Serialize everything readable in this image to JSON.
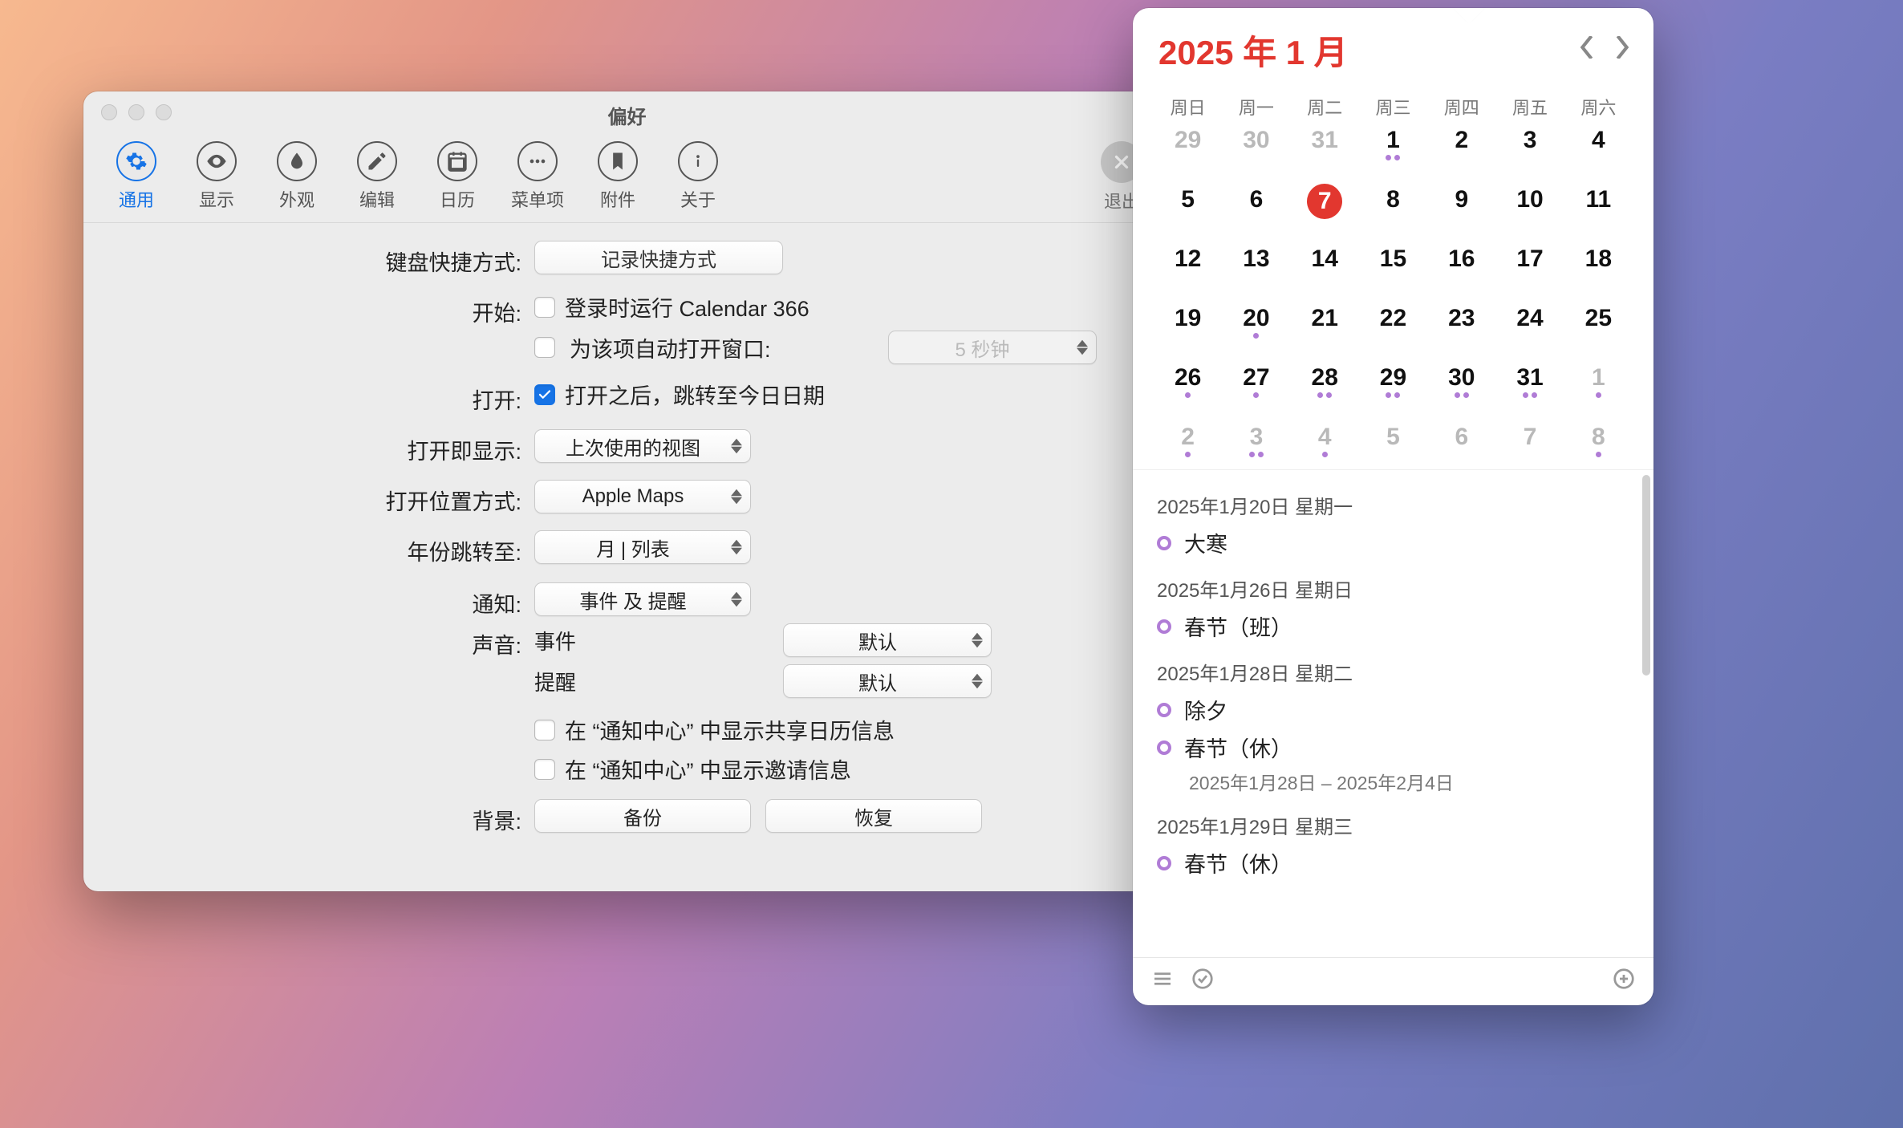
{
  "prefs": {
    "title": "偏好",
    "toolbar": [
      {
        "key": "general",
        "label": "通用",
        "active": true
      },
      {
        "key": "display",
        "label": "显示"
      },
      {
        "key": "appearance",
        "label": "外观"
      },
      {
        "key": "editing",
        "label": "编辑"
      },
      {
        "key": "calendar",
        "label": "日历"
      },
      {
        "key": "menu",
        "label": "菜单项"
      },
      {
        "key": "attachments",
        "label": "附件"
      },
      {
        "key": "about",
        "label": "关于"
      }
    ],
    "quit_label": "退出",
    "rows": {
      "keyboard_shortcut_label": "键盘快捷方式:",
      "keyboard_record_button": "记录快捷方式",
      "start_label": "开始:",
      "start_login": "登录时运行 Calendar 366",
      "start_auto_open": "为该项自动打开窗口:",
      "start_auto_open_select": "5 秒钟",
      "open_label": "打开:",
      "open_jump_today": "打开之后，跳转至今日日期",
      "open_show_label": "打开即显示:",
      "open_show_value": "上次使用的视图",
      "open_location_label": "打开位置方式:",
      "open_location_value": "Apple Maps",
      "year_jump_label": "年份跳转至:",
      "year_jump_value": "月 | 列表",
      "notify_label": "通知:",
      "notify_value": "事件 及 提醒",
      "sound_label": "声音:",
      "sound_events_label": "事件",
      "sound_events_value": "默认",
      "sound_reminders_label": "提醒",
      "sound_reminders_value": "默认",
      "nc_shared": "在 “通知中心” 中显示共享日历信息",
      "nc_invite": "在 “通知中心” 中显示邀请信息",
      "background_label": "背景:",
      "background_backup": "备份",
      "background_restore": "恢复"
    }
  },
  "calendar": {
    "title_year": "2025 年",
    "title_month": "1 月",
    "weekdays": [
      "周日",
      "周一",
      "周二",
      "周三",
      "周四",
      "周五",
      "周六"
    ],
    "grid": [
      {
        "n": "29",
        "outside": true
      },
      {
        "n": "30",
        "outside": true
      },
      {
        "n": "31",
        "outside": true
      },
      {
        "n": "1",
        "dots": 2
      },
      {
        "n": "2"
      },
      {
        "n": "3"
      },
      {
        "n": "4"
      },
      {
        "n": "5"
      },
      {
        "n": "6"
      },
      {
        "n": "7",
        "today": true
      },
      {
        "n": "8"
      },
      {
        "n": "9"
      },
      {
        "n": "10"
      },
      {
        "n": "11"
      },
      {
        "n": "12"
      },
      {
        "n": "13"
      },
      {
        "n": "14"
      },
      {
        "n": "15"
      },
      {
        "n": "16"
      },
      {
        "n": "17"
      },
      {
        "n": "18"
      },
      {
        "n": "19"
      },
      {
        "n": "20",
        "dots": 1
      },
      {
        "n": "21"
      },
      {
        "n": "22"
      },
      {
        "n": "23"
      },
      {
        "n": "24"
      },
      {
        "n": "25"
      },
      {
        "n": "26",
        "dots": 1
      },
      {
        "n": "27",
        "dots": 1
      },
      {
        "n": "28",
        "dots": 2
      },
      {
        "n": "29",
        "dots": 2
      },
      {
        "n": "30",
        "dots": 2
      },
      {
        "n": "31",
        "dots": 2
      },
      {
        "n": "1",
        "outside": true,
        "dots": 1
      },
      {
        "n": "2",
        "outside": true,
        "dots": 1
      },
      {
        "n": "3",
        "outside": true,
        "dots": 2
      },
      {
        "n": "4",
        "outside": true,
        "dots": 1
      },
      {
        "n": "5",
        "outside": true
      },
      {
        "n": "6",
        "outside": true
      },
      {
        "n": "7",
        "outside": true
      },
      {
        "n": "8",
        "outside": true,
        "dots": 1
      }
    ],
    "events": [
      {
        "date": "2025年1月20日 星期一",
        "items": [
          {
            "title": "大寒"
          }
        ]
      },
      {
        "date": "2025年1月26日 星期日",
        "items": [
          {
            "title": "春节（班）"
          }
        ]
      },
      {
        "date": "2025年1月28日 星期二",
        "items": [
          {
            "title": "除夕"
          },
          {
            "title": "春节（休）",
            "sub": "2025年1月28日 – 2025年2月4日"
          }
        ]
      },
      {
        "date": "2025年1月29日 星期三",
        "items": [
          {
            "title": "春节（休）"
          }
        ]
      }
    ]
  }
}
